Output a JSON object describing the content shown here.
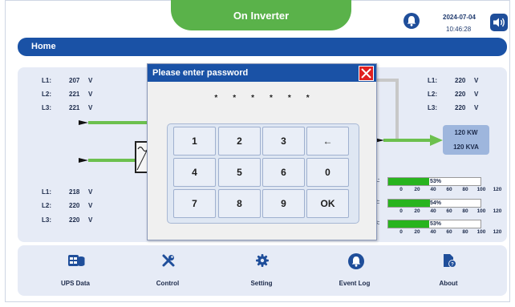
{
  "app": {
    "title": "On Inverter"
  },
  "status": {
    "date": "2024-07-04",
    "time": "10:46:28"
  },
  "header": {
    "title": "Home"
  },
  "input_readings": [
    {
      "label": "L1:",
      "value": "207",
      "unit": "V"
    },
    {
      "label": "L2:",
      "value": "221",
      "unit": "V"
    },
    {
      "label": "L3:",
      "value": "221",
      "unit": "V"
    }
  ],
  "bypass_readings": [
    {
      "label": "L1:",
      "value": "218",
      "unit": "V"
    },
    {
      "label": "L2:",
      "value": "220",
      "unit": "V"
    },
    {
      "label": "L3:",
      "value": "220",
      "unit": "V"
    }
  ],
  "output_readings": [
    {
      "label": "L1:",
      "value": "220",
      "unit": "V"
    },
    {
      "label": "L2:",
      "value": "220",
      "unit": "V"
    },
    {
      "label": "L3:",
      "value": "220",
      "unit": "V"
    }
  ],
  "power": {
    "kw": "120 KW",
    "kva": "120 KVA"
  },
  "load_bars": {
    "ticks": [
      "0",
      "20",
      "40",
      "60",
      "80",
      "100",
      "120"
    ],
    "max": 120,
    "items": [
      {
        "label": "1:",
        "percent": 53,
        "text": "53%"
      },
      {
        "label": "2:",
        "percent": 54,
        "text": "54%"
      },
      {
        "label": "3:",
        "percent": 53,
        "text": "53%"
      }
    ]
  },
  "nav": {
    "items": [
      {
        "label": "UPS Data",
        "icon": "ups-data-icon"
      },
      {
        "label": "Control",
        "icon": "tools-icon"
      },
      {
        "label": "Setting",
        "icon": "gear-icon"
      },
      {
        "label": "Event Log",
        "icon": "bell-icon"
      },
      {
        "label": "About",
        "icon": "about-document-icon"
      }
    ]
  },
  "dialog": {
    "title": "Please enter password",
    "masked_value": "******",
    "keys": [
      "1",
      "2",
      "3",
      "←",
      "4",
      "5",
      "6",
      "0",
      "7",
      "8",
      "9",
      "OK"
    ]
  },
  "colors": {
    "accent_green": "#5ab24a",
    "primary_blue": "#1a52a6",
    "panel_bg": "#e6ebf6",
    "bar_green": "#28b41e",
    "close_red": "#e02020"
  }
}
